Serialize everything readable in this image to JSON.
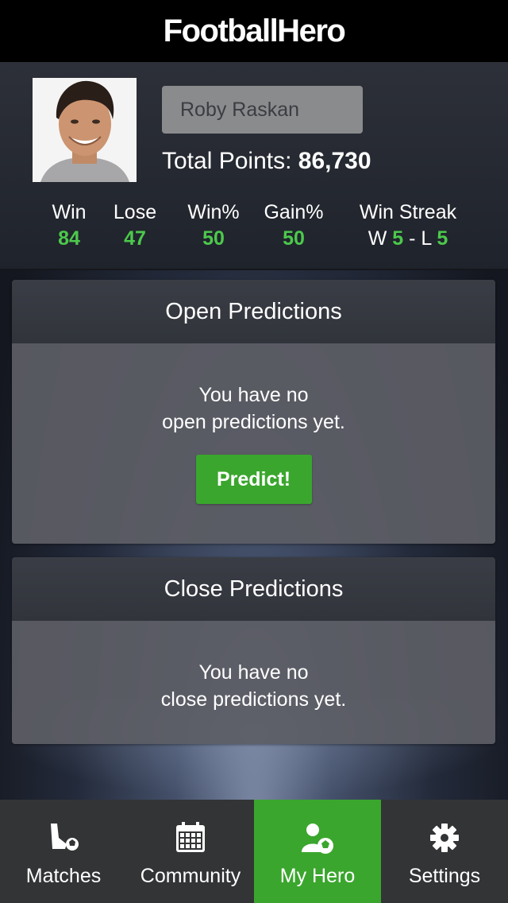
{
  "app": {
    "title": "FootballHero"
  },
  "profile": {
    "name": "Roby Raskan",
    "total_points_label": "Total Points:",
    "total_points_value": "86,730",
    "stats": [
      {
        "label": "Win",
        "value": "84"
      },
      {
        "label": "Lose",
        "value": "47"
      },
      {
        "label": "Win%",
        "value": "50"
      },
      {
        "label": "Gain%",
        "value": "50"
      }
    ],
    "streak": {
      "label": "Win Streak",
      "w_prefix": "W",
      "w_value": "5",
      "sep": "-",
      "l_prefix": "L",
      "l_value": "5"
    }
  },
  "open_predictions": {
    "title": "Open Predictions",
    "message_line1": "You have no",
    "message_line2": "open predictions yet.",
    "button_label": "Predict!"
  },
  "close_predictions": {
    "title": "Close Predictions",
    "message_line1": "You have no",
    "message_line2": "close predictions yet."
  },
  "tabbar": {
    "active": "My Hero",
    "tabs": [
      {
        "label": "Matches",
        "icon": "boot-ball-icon"
      },
      {
        "label": "Community",
        "icon": "calendar-icon"
      },
      {
        "label": "My Hero",
        "icon": "user-ball-icon"
      },
      {
        "label": "Settings",
        "icon": "gear-icon"
      }
    ]
  },
  "colors": {
    "accent_green": "#3aa62d",
    "stat_green": "#4cc94c",
    "topbar": "#000000",
    "tabbar": "#333436"
  }
}
